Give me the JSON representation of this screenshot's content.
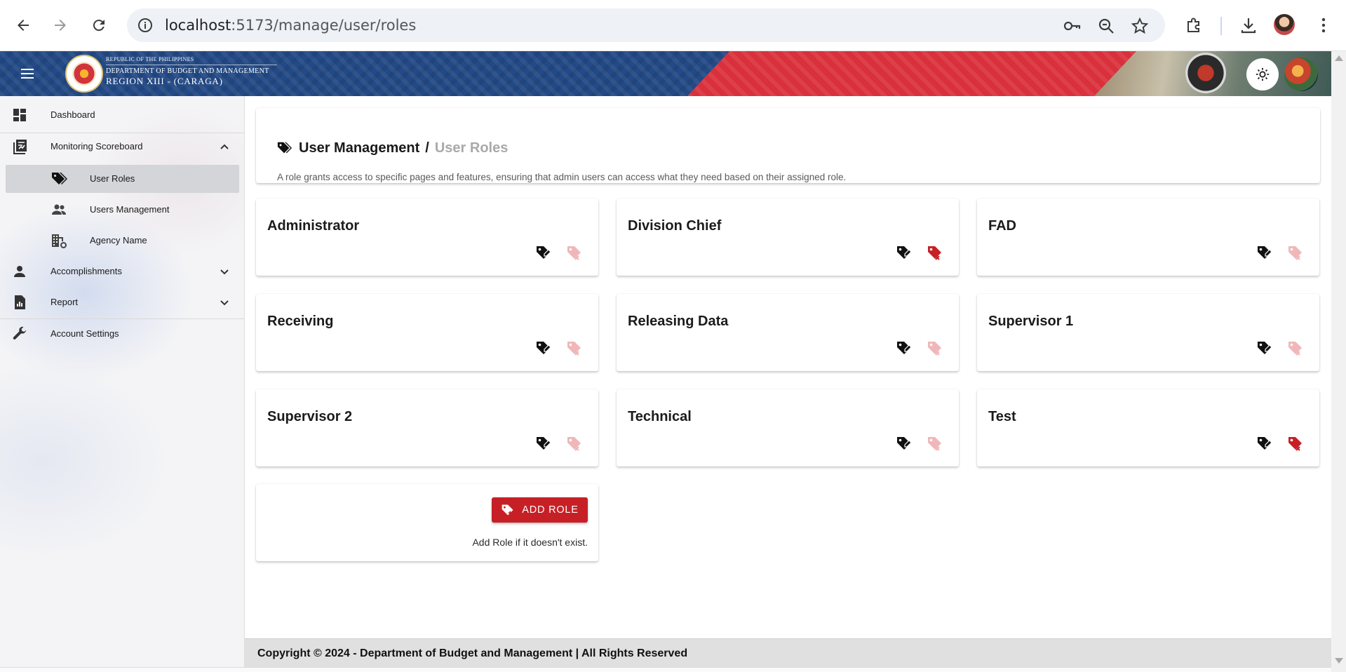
{
  "browser": {
    "url_host": "localhost",
    "url_path": ":5173/manage/user/roles"
  },
  "header": {
    "agency_line1": "REPUBLIC OF THE PHILIPPINES",
    "agency_line2": "DEPARTMENT OF BUDGET AND MANAGEMENT",
    "agency_line3": "REGION XIII - (CARAGA)"
  },
  "sidebar": {
    "items": [
      {
        "label": "Dashboard"
      },
      {
        "label": "Monitoring Scoreboard"
      },
      {
        "label": "User Roles"
      },
      {
        "label": "Users Management"
      },
      {
        "label": "Agency Name"
      },
      {
        "label": "Accomplishments"
      },
      {
        "label": "Report"
      },
      {
        "label": "Account Settings"
      }
    ],
    "active": "User Roles"
  },
  "page": {
    "breadcrumb_parent": "User Management",
    "breadcrumb_separator": "/",
    "breadcrumb_current": "User Roles",
    "description": "A role grants access to specific pages and features, ensuring that admin users can access what they need based on their assigned role."
  },
  "roles": [
    {
      "name": "Administrator",
      "delete_enabled": false
    },
    {
      "name": "Division Chief",
      "delete_enabled": true
    },
    {
      "name": "FAD",
      "delete_enabled": false
    },
    {
      "name": "Receiving",
      "delete_enabled": false
    },
    {
      "name": "Releasing Data",
      "delete_enabled": false
    },
    {
      "name": "Supervisor 1",
      "delete_enabled": false
    },
    {
      "name": "Supervisor 2",
      "delete_enabled": false
    },
    {
      "name": "Technical",
      "delete_enabled": false
    },
    {
      "name": "Test",
      "delete_enabled": true
    }
  ],
  "add_role": {
    "button_label": "ADD ROLE",
    "note": "Add Role if it doesn't exist."
  },
  "footer": {
    "text": "Copyright © 2024 - Department of Budget and Management | All Rights Reserved"
  },
  "colors": {
    "header_blue": "#234a86",
    "header_red": "#d9303b",
    "accent_red": "#c62026",
    "delete_enabled": "#c62026",
    "delete_disabled": "#efb7b9"
  }
}
